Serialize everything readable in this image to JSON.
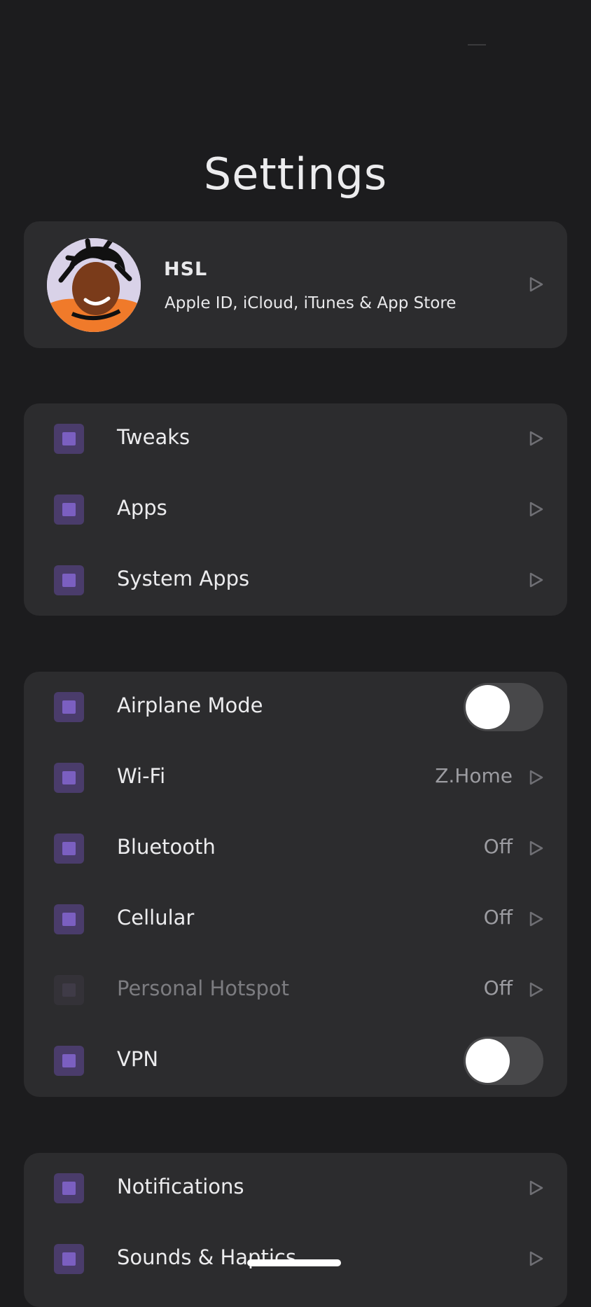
{
  "header": {
    "title": "Settings"
  },
  "profile": {
    "name": "HSL",
    "subtitle": "Apple ID, iCloud, iTunes & App Store"
  },
  "section_tweaks": {
    "items": [
      {
        "label": "Tweaks"
      },
      {
        "label": "Apps"
      },
      {
        "label": "System Apps"
      }
    ]
  },
  "section_connectivity": {
    "airplane": {
      "label": "Airplane Mode",
      "state": "off"
    },
    "wifi": {
      "label": "Wi-Fi",
      "value": "Z.Home"
    },
    "bluetooth": {
      "label": "Bluetooth",
      "value": "Off"
    },
    "cellular": {
      "label": "Cellular",
      "value": "Off"
    },
    "hotspot": {
      "label": "Personal Hotspot",
      "value": "Off",
      "disabled": true
    },
    "vpn": {
      "label": "VPN",
      "state": "off"
    }
  },
  "section_notifications": {
    "items": [
      {
        "label": "Notifications"
      },
      {
        "label": "Sounds & Haptics"
      }
    ]
  },
  "colors": {
    "background": "#1c1c1e",
    "card": "#2c2c2e",
    "accent": "#7b5fc1",
    "text": "#ececee",
    "secondary_text": "#9c9ca1"
  },
  "icons": {
    "row_icon": "purple-square-icon",
    "disclosure": "chevron-right-icon"
  }
}
